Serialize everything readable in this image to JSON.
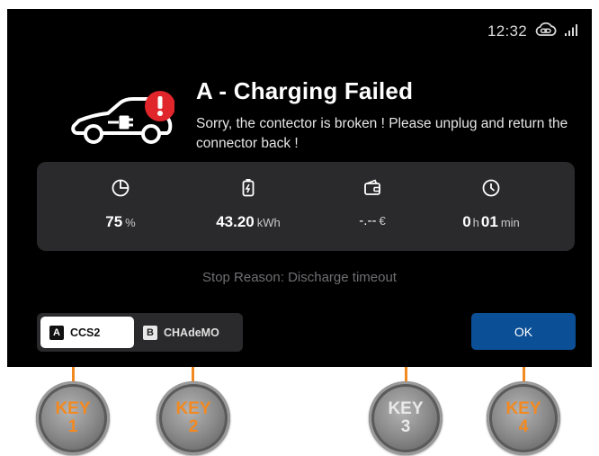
{
  "status_bar": {
    "time": "12:32"
  },
  "header": {
    "title": "A - Charging Failed",
    "message": "Sorry, the contector is broken ! Please unplug and return the connector back !"
  },
  "stats": [
    {
      "icon": "pie-chart-icon",
      "value": "75",
      "unit": "%"
    },
    {
      "icon": "battery-charge-icon",
      "value": "43.20",
      "unit": "kWh"
    },
    {
      "icon": "wallet-icon",
      "value": "-.--",
      "unit": "€"
    },
    {
      "icon": "clock-icon",
      "hours": "0",
      "hours_unit": "h",
      "minutes": "01",
      "minutes_unit": "min"
    }
  ],
  "stop_reason": "Stop Reason: Discharge timeout",
  "connectors": [
    {
      "letter": "A",
      "label": "CCS2",
      "selected": true
    },
    {
      "letter": "B",
      "label": "CHAdeMO",
      "selected": false
    }
  ],
  "ok_label": "OK",
  "keys": [
    {
      "word": "KEY",
      "number": "1",
      "color": "#f3891f"
    },
    {
      "word": "KEY",
      "number": "2",
      "color": "#f3891f"
    },
    {
      "word": "KEY",
      "number": "3",
      "color": "#e9e9e9"
    },
    {
      "word": "KEY",
      "number": "4",
      "color": "#f3891f"
    }
  ],
  "colors": {
    "screen_bg": "#000000",
    "panel_bg": "#2a2a2c",
    "ok_button": "#0b4f97",
    "error_badge": "#e0262b",
    "key_accent": "#f28a22"
  }
}
